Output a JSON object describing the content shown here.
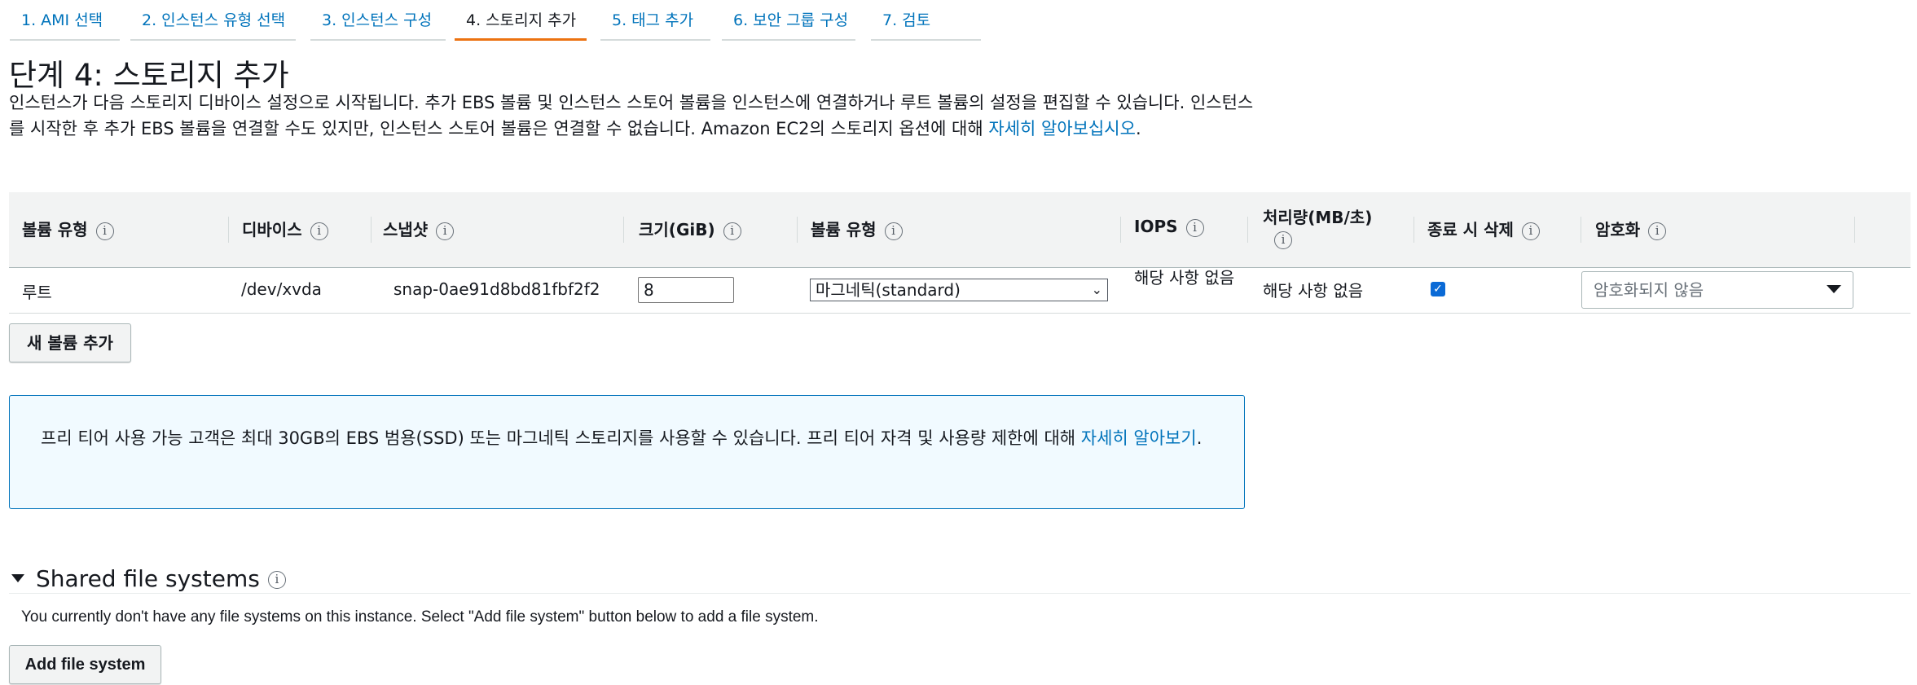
{
  "tabs": [
    {
      "label": "1. AMI 선택",
      "active": false
    },
    {
      "label": "2. 인스턴스 유형 선택",
      "active": false
    },
    {
      "label": "3. 인스턴스 구성",
      "active": false
    },
    {
      "label": "4. 스토리지 추가",
      "active": true
    },
    {
      "label": "5. 태그 추가",
      "active": false
    },
    {
      "label": "6. 보안 그룹 구성",
      "active": false
    },
    {
      "label": "7. 검토",
      "active": false
    }
  ],
  "page": {
    "title": "단계 4: 스토리지 추가",
    "description": "인스턴스가 다음 스토리지 디바이스 설정으로 시작됩니다. 추가 EBS 볼륨 및 인스턴스 스토어 볼륨을 인스턴스에 연결하거나 루트 볼륨의 설정을 편집할 수 있습니다. 인스턴스를 시작한 후 추가 EBS 볼륨을 연결할 수도 있지만, 인스턴스 스토어 볼륨은 연결할 수 없습니다. Amazon EC2의 스토리지 옵션에 대해 ",
    "description_link": "자세히 알아보십시오",
    "description_end": "."
  },
  "table": {
    "headers": {
      "volume_type": "볼륨 유형",
      "device": "디바이스",
      "snapshot": "스냅샷",
      "size": "크기(GiB)",
      "ebs_type": "볼륨 유형",
      "iops": "IOPS",
      "throughput": "처리량(MB/초)",
      "delete_on_termination": "종료 시 삭제",
      "encryption": "암호화"
    },
    "info_glyph": "i",
    "row": {
      "volume_type": "루트",
      "device": "/dev/xvda",
      "snapshot": "snap-0ae91d8bd81fbf2f2",
      "size": "8",
      "ebs_type": "마그네틱(standard)",
      "iops": "해당 사항 없음",
      "throughput": "해당 사항 없음",
      "delete_on_termination": true,
      "encryption_placeholder": "암호화되지 않음"
    }
  },
  "buttons": {
    "add_volume": "새 볼륨 추가",
    "add_file_system": "Add file system"
  },
  "free_tier": {
    "text": "프리 티어 사용 가능 고객은 최대 30GB의 EBS 범용(SSD) 또는 마그네틱 스토리지를 사용할 수 있습니다. 프리 티어 자격 및 사용량 제한에 대해 ",
    "link": "자세히 알아보기",
    "end": "."
  },
  "shared_fs": {
    "title": "Shared file systems",
    "message": "You currently don't have any file systems on this instance. Select \"Add file system\" button below to add a file system."
  },
  "colors": {
    "link": "#0073bb",
    "active_tab": "#ec7211",
    "checkbox": "#0a6ad6",
    "info_border": "#0073bb",
    "info_bg": "#f1faff"
  }
}
